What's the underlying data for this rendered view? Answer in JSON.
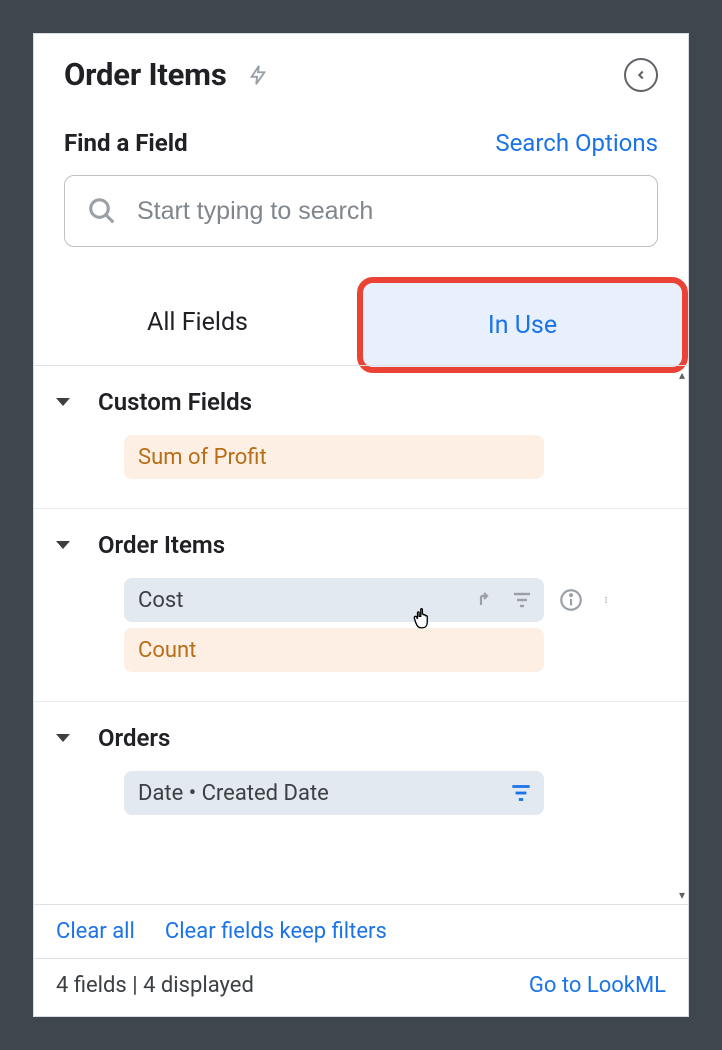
{
  "header": {
    "title": "Order Items"
  },
  "search": {
    "find_label": "Find a Field",
    "options_label": "Search Options",
    "placeholder": "Start typing to search"
  },
  "tabs": {
    "all": "All Fields",
    "in_use": "In Use"
  },
  "sections": [
    {
      "title": "Custom Fields",
      "fields": [
        {
          "label": "Sum of Profit",
          "type": "measure"
        }
      ]
    },
    {
      "title": "Order Items",
      "fields": [
        {
          "label": "Cost",
          "type": "dimension",
          "hover": true
        },
        {
          "label": "Count",
          "type": "measure"
        }
      ]
    },
    {
      "title": "Orders",
      "fields": [
        {
          "label": "Date • Created Date",
          "type": "dimension",
          "filter": true
        }
      ]
    }
  ],
  "footer": {
    "clear_all": "Clear all",
    "clear_keep": "Clear fields keep filters",
    "status": "4 fields | 4 displayed",
    "lookml": "Go to LookML"
  }
}
